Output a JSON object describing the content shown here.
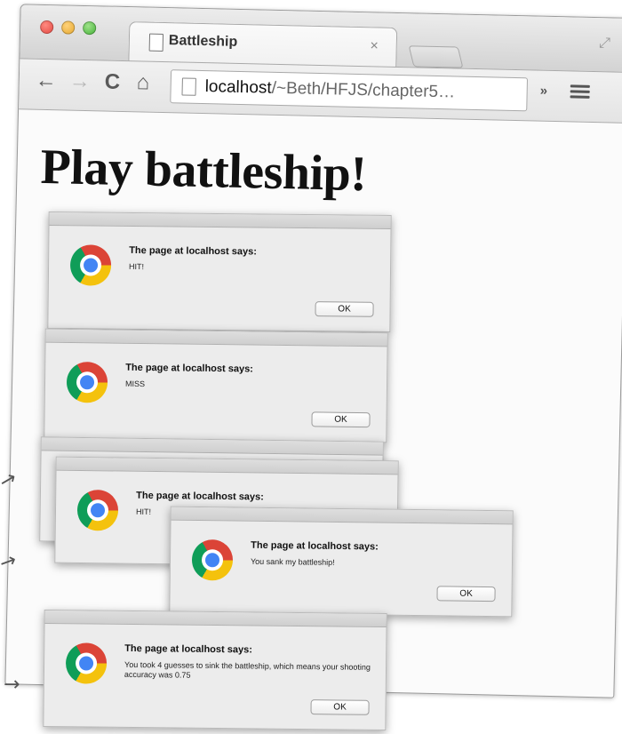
{
  "browser": {
    "tab_title": "Battleship",
    "tab_close": "×",
    "url_host": "localhost",
    "url_rest": "/~Beth/HFJS/chapter5…",
    "icons": {
      "back": "back-arrow-icon",
      "forward": "forward-arrow-icon",
      "reload": "reload-icon",
      "home": "home-icon",
      "extensions": "overflow-chevron-icon",
      "menu": "hamburger-menu-icon"
    },
    "glyphs": {
      "back": "←",
      "forward": "→",
      "reload": "C",
      "home": "⌂",
      "extensions": "»",
      "resize": "⤢"
    }
  },
  "page": {
    "heading": "Play battleship!"
  },
  "dialogs": [
    {
      "title": "The page at localhost says:",
      "message": "HIT!",
      "button": "OK"
    },
    {
      "title": "The page at localhost says:",
      "message": "MISS",
      "button": "OK"
    },
    {
      "title": "",
      "message": "",
      "button": ""
    },
    {
      "title": "The page at localhost says:",
      "message": "HIT!",
      "button": ""
    },
    {
      "title": "The page at localhost says:",
      "message": "You sank my battleship!",
      "button": "OK"
    },
    {
      "title": "The page at localhost says:",
      "message": "You took 4 guesses to sink the battleship, which means your shooting accuracy was 0.75",
      "button": "OK"
    }
  ],
  "annotations": {
    "arrow_glyph": "→"
  },
  "colors": {
    "chrome_red": "#db4437",
    "chrome_yellow": "#f4c20d",
    "chrome_green": "#0f9d58",
    "chrome_blue": "#4285f4"
  }
}
